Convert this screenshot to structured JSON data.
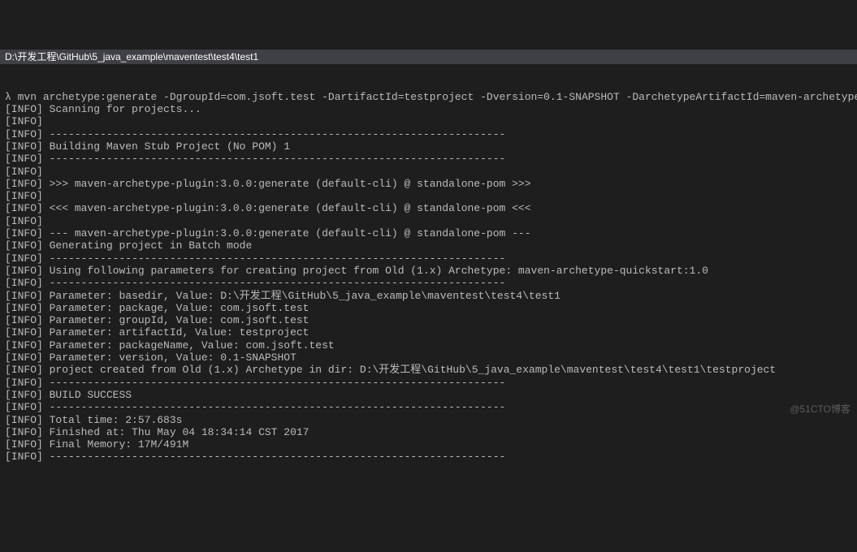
{
  "titlebar": {
    "path": "D:\\开发工程\\GitHub\\5_java_example\\maventest\\test4\\test1"
  },
  "prompt": {
    "glyph": "λ",
    "command": "mvn archetype:generate -DgroupId=com.jsoft.test -DartifactId=testproject -Dversion=0.1-SNAPSHOT -DarchetypeArtifactId=maven-archetype-quickstart -DinteractiveMode=false"
  },
  "dashline": "------------------------------------------------------------------------",
  "lines": [
    {
      "tag": "[INFO]",
      "text": "Scanning for projects..."
    },
    {
      "tag": "[INFO]",
      "text": ""
    },
    {
      "tag": "[INFO]",
      "dash": true
    },
    {
      "tag": "[INFO]",
      "text": "Building Maven Stub Project (No POM) 1"
    },
    {
      "tag": "[INFO]",
      "dash": true
    },
    {
      "tag": "[INFO]",
      "text": ""
    },
    {
      "tag": "[INFO]",
      "text": ">>> maven-archetype-plugin:3.0.0:generate (default-cli) @ standalone-pom >>>"
    },
    {
      "tag": "[INFO]",
      "text": ""
    },
    {
      "tag": "[INFO]",
      "text": "<<< maven-archetype-plugin:3.0.0:generate (default-cli) @ standalone-pom <<<"
    },
    {
      "tag": "[INFO]",
      "text": ""
    },
    {
      "tag": "[INFO]",
      "text": "--- maven-archetype-plugin:3.0.0:generate (default-cli) @ standalone-pom ---"
    },
    {
      "tag": "[INFO]",
      "text": "Generating project in Batch mode"
    },
    {
      "tag": "[INFO]",
      "dash": true
    },
    {
      "tag": "[INFO]",
      "text": "Using following parameters for creating project from Old (1.x) Archetype: maven-archetype-quickstart:1.0"
    },
    {
      "tag": "[INFO]",
      "dash": true
    },
    {
      "tag": "[INFO]",
      "text": "Parameter: basedir, Value: D:\\开发工程\\GitHub\\5_java_example\\maventest\\test4\\test1"
    },
    {
      "tag": "[INFO]",
      "text": "Parameter: package, Value: com.jsoft.test"
    },
    {
      "tag": "[INFO]",
      "text": "Parameter: groupId, Value: com.jsoft.test"
    },
    {
      "tag": "[INFO]",
      "text": "Parameter: artifactId, Value: testproject"
    },
    {
      "tag": "[INFO]",
      "text": "Parameter: packageName, Value: com.jsoft.test"
    },
    {
      "tag": "[INFO]",
      "text": "Parameter: version, Value: 0.1-SNAPSHOT"
    },
    {
      "tag": "[INFO]",
      "text": "project created from Old (1.x) Archetype in dir: D:\\开发工程\\GitHub\\5_java_example\\maventest\\test4\\test1\\testproject"
    },
    {
      "tag": "[INFO]",
      "dash": true
    },
    {
      "tag": "[INFO]",
      "text": "BUILD SUCCESS"
    },
    {
      "tag": "[INFO]",
      "dash": true
    },
    {
      "tag": "[INFO]",
      "text": "Total time: 2:57.683s"
    },
    {
      "tag": "[INFO]",
      "text": "Finished at: Thu May 04 18:34:14 CST 2017"
    },
    {
      "tag": "[INFO]",
      "text": "Final Memory: 17M/491M"
    },
    {
      "tag": "[INFO]",
      "dash": true
    }
  ],
  "watermark": "@51CTO博客"
}
